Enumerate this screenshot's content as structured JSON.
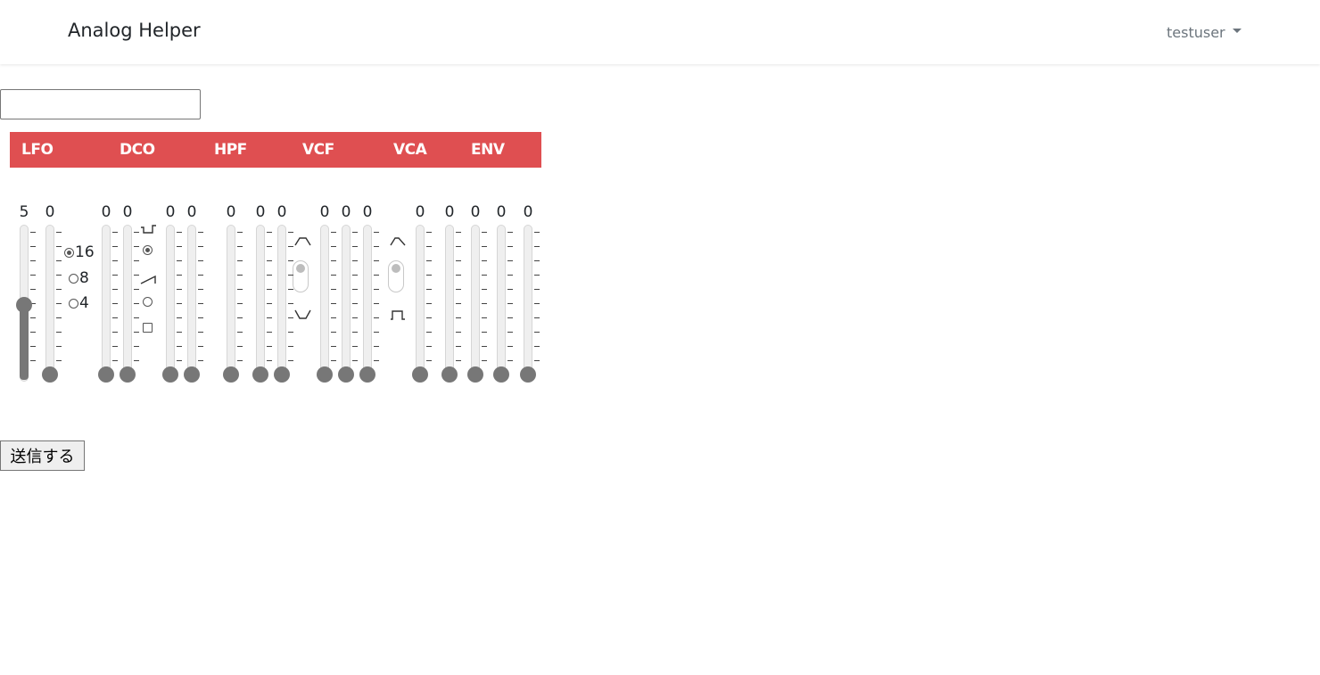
{
  "navbar": {
    "brand": "Analog Helper",
    "user": "testuser"
  },
  "form": {
    "name_value": "",
    "submit_label": "送信する"
  },
  "sections": [
    "LFO",
    "DCO",
    "HPF",
    "VCF",
    "VCA",
    "ENV"
  ],
  "faders": [
    {
      "id": "lfo-rate",
      "value": "5",
      "level": 0.5
    },
    {
      "id": "lfo-delay",
      "value": "0",
      "level": 0
    },
    {
      "id": "dco-lfo",
      "value": "0",
      "level": 0
    },
    {
      "id": "dco-pwm",
      "value": "0",
      "level": 0
    },
    {
      "id": "dco-sub",
      "value": "0",
      "level": 0
    },
    {
      "id": "dco-noise",
      "value": "0",
      "level": 0
    },
    {
      "id": "hpf-freq",
      "value": "0",
      "level": 0
    },
    {
      "id": "vcf-freq",
      "value": "0",
      "level": 0
    },
    {
      "id": "vcf-res",
      "value": "0",
      "level": 0
    },
    {
      "id": "vcf-env",
      "value": "0",
      "level": 0
    },
    {
      "id": "vcf-lfo",
      "value": "0",
      "level": 0
    },
    {
      "id": "vcf-kybd",
      "value": "0",
      "level": 0
    },
    {
      "id": "vca-level",
      "value": "0",
      "level": 0
    },
    {
      "id": "env-attack",
      "value": "0",
      "level": 0
    },
    {
      "id": "env-decay",
      "value": "0",
      "level": 0
    },
    {
      "id": "env-sustain",
      "value": "0",
      "level": 0
    },
    {
      "id": "env-release",
      "value": "0",
      "level": 0
    }
  ],
  "range": {
    "options": [
      "16",
      "8",
      "4"
    ],
    "selected": "16"
  },
  "dco_wave": {
    "options": [
      "pulse",
      "saw",
      "off",
      "square-off"
    ],
    "selected": "pulse",
    "icons": [
      "pulse-wave-icon",
      "sawtooth-wave-icon"
    ]
  },
  "vcf_env_polarity": {
    "selected": "positive",
    "icons": [
      "positive-envelope-icon",
      "negative-envelope-icon"
    ]
  },
  "vca_mode": {
    "selected": "env",
    "icons": [
      "envelope-icon",
      "gate-icon"
    ]
  },
  "colors": {
    "section_bar": "#df4f51",
    "fader_fill": "#777777"
  }
}
